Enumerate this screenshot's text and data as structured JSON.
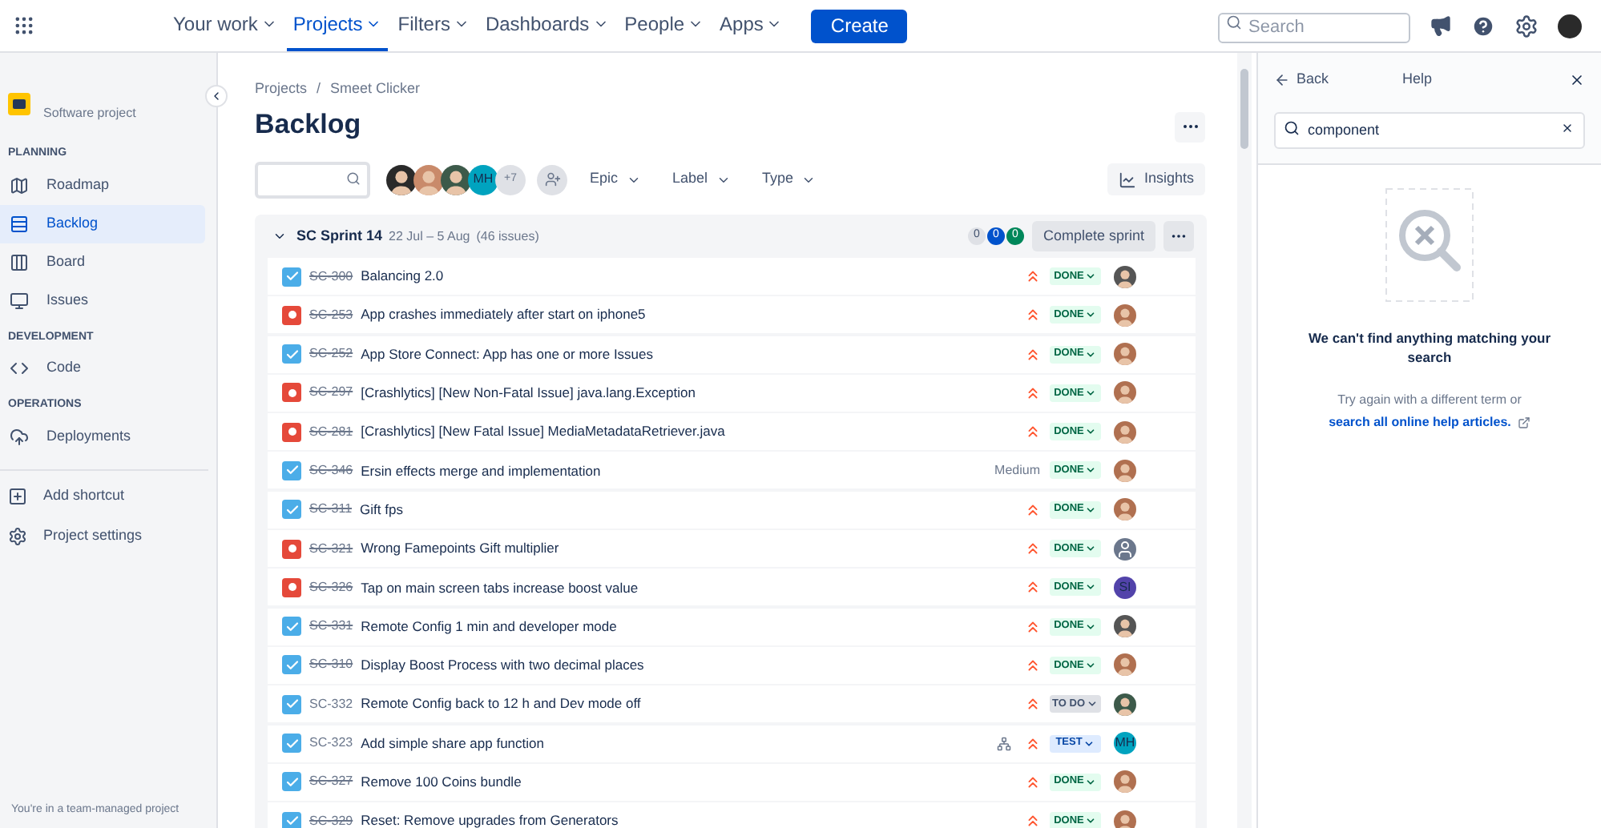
{
  "top_nav": {
    "items": [
      {
        "label": "Your work",
        "selected": false
      },
      {
        "label": "Projects",
        "selected": true
      },
      {
        "label": "Filters",
        "selected": false
      },
      {
        "label": "Dashboards",
        "selected": false
      },
      {
        "label": "People",
        "selected": false
      },
      {
        "label": "Apps",
        "selected": false
      }
    ],
    "create": "Create",
    "search": {
      "placeholder": "Search"
    }
  },
  "sidebar": {
    "project_type": "Software project",
    "sections": [
      {
        "title": "PLANNING",
        "items": [
          {
            "label": "Roadmap",
            "kind": "roadmap",
            "selected": false
          },
          {
            "label": "Backlog",
            "kind": "backlog",
            "selected": true
          },
          {
            "label": "Board",
            "kind": "board",
            "selected": false
          },
          {
            "label": "Issues",
            "kind": "issues",
            "selected": false
          }
        ]
      },
      {
        "title": "DEVELOPMENT",
        "items": [
          {
            "label": "Code",
            "kind": "code",
            "selected": false
          }
        ]
      },
      {
        "title": "OPERATIONS",
        "items": [
          {
            "label": "Deployments",
            "kind": "deploy",
            "selected": false
          }
        ]
      }
    ],
    "bottom_items": [
      {
        "label": "Add shortcut",
        "kind": "shortcut"
      },
      {
        "label": "Project settings",
        "kind": "settings"
      }
    ],
    "footer": "You're in a team-managed project"
  },
  "breadcrumb": {
    "items": [
      "Projects",
      "Smeet Clicker"
    ],
    "separator": "/"
  },
  "title": "Backlog",
  "filters": {
    "avatars": [
      {
        "kind": "photo",
        "color": "#2a2a2a"
      },
      {
        "kind": "photo",
        "color": "#c98a6a"
      },
      {
        "kind": "photo",
        "color": "#3d5a4a"
      },
      {
        "kind": "initials",
        "text": "MH",
        "color": "#00a3bf"
      }
    ],
    "more": "+7",
    "dropdowns": [
      "Epic",
      "Label",
      "Type"
    ],
    "insights": "Insights"
  },
  "sprint": {
    "name": "SC Sprint 14",
    "dates": "22 Jul – 5 Aug",
    "count": "(46 issues)",
    "counters": [
      {
        "value": "0",
        "kind": "todo"
      },
      {
        "value": "0",
        "kind": "progress"
      },
      {
        "value": "0",
        "kind": "done"
      }
    ],
    "complete": "Complete sprint",
    "issues": [
      {
        "kind": "story",
        "key": "SC-300",
        "done": true,
        "summary": "Balancing 2.0",
        "priority": {
          "kind": "icon"
        },
        "status": {
          "text": "DONE",
          "kind": "done"
        },
        "assignee": {
          "kind": "photo",
          "color": "#555555"
        }
      },
      {
        "kind": "bug",
        "key": "SC-253",
        "done": true,
        "summary": "App crashes immediately after start on iphone5",
        "priority": {
          "kind": "icon"
        },
        "status": {
          "text": "DONE",
          "kind": "done"
        },
        "assignee": {
          "kind": "photo",
          "color": "#b07050"
        }
      },
      {
        "kind": "story",
        "key": "SC-252",
        "done": true,
        "summary": "App Store Connect: App has one or more Issues",
        "priority": {
          "kind": "icon"
        },
        "status": {
          "text": "DONE",
          "kind": "done"
        },
        "assignee": {
          "kind": "photo",
          "color": "#b07050"
        }
      },
      {
        "kind": "bug",
        "key": "SC-297",
        "done": true,
        "summary": "[Crashlytics] [New Non-Fatal Issue] java.lang.Exception",
        "priority": {
          "kind": "icon"
        },
        "status": {
          "text": "DONE",
          "kind": "done"
        },
        "assignee": {
          "kind": "photo",
          "color": "#b07050"
        }
      },
      {
        "kind": "bug",
        "key": "SC-281",
        "done": true,
        "summary": "[Crashlytics] [New Fatal Issue] MediaMetadataRetriever.java",
        "priority": {
          "kind": "icon"
        },
        "status": {
          "text": "DONE",
          "kind": "done"
        },
        "assignee": {
          "kind": "photo",
          "color": "#b07050"
        }
      },
      {
        "kind": "story",
        "key": "SC-346",
        "done": true,
        "summary": "Ersin effects merge and implementation",
        "priority": {
          "kind": "text",
          "text": "Medium"
        },
        "status": {
          "text": "DONE",
          "kind": "done"
        },
        "assignee": {
          "kind": "photo",
          "color": "#b07050"
        }
      },
      {
        "kind": "story",
        "key": "SC-311",
        "done": true,
        "summary": "Gift fps",
        "priority": {
          "kind": "icon"
        },
        "status": {
          "text": "DONE",
          "kind": "done"
        },
        "assignee": {
          "kind": "photo",
          "color": "#b07050"
        }
      },
      {
        "kind": "bug",
        "key": "SC-321",
        "done": true,
        "summary": "Wrong Famepoints Gift multiplier",
        "priority": {
          "kind": "icon"
        },
        "status": {
          "text": "DONE",
          "kind": "done"
        },
        "assignee": {
          "kind": "default"
        }
      },
      {
        "kind": "bug",
        "key": "SC-326",
        "done": true,
        "summary": "Tap on main screen tabs increase boost value",
        "priority": {
          "kind": "icon"
        },
        "status": {
          "text": "DONE",
          "kind": "done"
        },
        "assignee": {
          "kind": "initials",
          "text": "SI",
          "color": "#5243aa"
        }
      },
      {
        "kind": "story",
        "key": "SC-331",
        "done": true,
        "summary": "Remote Config 1 min and developer mode",
        "priority": {
          "kind": "icon"
        },
        "status": {
          "text": "DONE",
          "kind": "done"
        },
        "assignee": {
          "kind": "photo",
          "color": "#555555"
        }
      },
      {
        "kind": "story",
        "key": "SC-310",
        "done": true,
        "summary": "Display Boost Process with two decimal places",
        "priority": {
          "kind": "icon"
        },
        "status": {
          "text": "DONE",
          "kind": "done"
        },
        "assignee": {
          "kind": "photo",
          "color": "#b07050"
        }
      },
      {
        "kind": "story",
        "key": "SC-332",
        "done": false,
        "summary": "Remote Config back to 12 h and Dev mode off",
        "priority": {
          "kind": "icon"
        },
        "status": {
          "text": "TO DO",
          "kind": "todo"
        },
        "assignee": {
          "kind": "photo",
          "color": "#3d5a4a"
        }
      },
      {
        "kind": "story",
        "key": "SC-323",
        "done": false,
        "summary": "Add simple share app function",
        "children": true,
        "priority": {
          "kind": "icon"
        },
        "status": {
          "text": "TEST",
          "kind": "test"
        },
        "assignee": {
          "kind": "initials",
          "text": "MH",
          "color": "#00a3bf"
        }
      },
      {
        "kind": "story",
        "key": "SC-327",
        "done": true,
        "summary": "Remove 100 Coins bundle",
        "priority": {
          "kind": "icon"
        },
        "status": {
          "text": "DONE",
          "kind": "done"
        },
        "assignee": {
          "kind": "photo",
          "color": "#b07050"
        }
      },
      {
        "kind": "story",
        "key": "SC-329",
        "done": true,
        "summary": "Reset: Remove upgrades from Generators",
        "priority": {
          "kind": "icon"
        },
        "status": {
          "text": "DONE",
          "kind": "done"
        },
        "assignee": {
          "kind": "photo",
          "color": "#b07050"
        }
      }
    ]
  },
  "help": {
    "back": "Back",
    "title": "Help",
    "search_value": "component",
    "empty_title": "We can't find anything matching your search",
    "empty_text": "Try again with a different term or",
    "link": "search all online help articles."
  }
}
